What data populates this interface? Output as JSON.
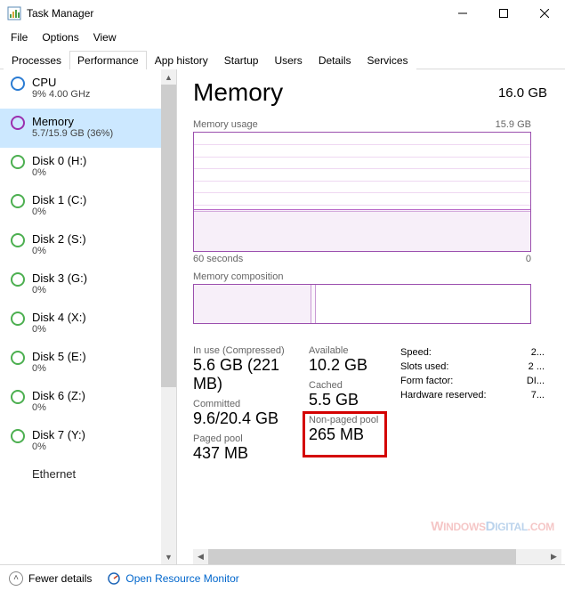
{
  "window": {
    "title": "Task Manager"
  },
  "menu": {
    "file": "File",
    "options": "Options",
    "view": "View"
  },
  "tabs": {
    "processes": "Processes",
    "performance": "Performance",
    "apphistory": "App history",
    "startup": "Startup",
    "users": "Users",
    "details": "Details",
    "services": "Services"
  },
  "sidebar": {
    "items": [
      {
        "label": "CPU",
        "sub": "9% 4.00 GHz",
        "ring": "blue"
      },
      {
        "label": "Memory",
        "sub": "5.7/15.9 GB (36%)",
        "ring": "purple"
      },
      {
        "label": "Disk 0 (H:)",
        "sub": "0%",
        "ring": "green"
      },
      {
        "label": "Disk 1 (C:)",
        "sub": "0%",
        "ring": "green"
      },
      {
        "label": "Disk 2 (S:)",
        "sub": "0%",
        "ring": "green"
      },
      {
        "label": "Disk 3 (G:)",
        "sub": "0%",
        "ring": "green"
      },
      {
        "label": "Disk 4 (X:)",
        "sub": "0%",
        "ring": "green"
      },
      {
        "label": "Disk 5 (E:)",
        "sub": "0%",
        "ring": "green"
      },
      {
        "label": "Disk 6 (Z:)",
        "sub": "0%",
        "ring": "green"
      },
      {
        "label": "Disk 7 (Y:)",
        "sub": "0%",
        "ring": "green"
      },
      {
        "label": "Ethernet",
        "sub": "",
        "ring": "green"
      }
    ],
    "selected": 1
  },
  "memory": {
    "title": "Memory",
    "total": "16.0 GB",
    "usage_label": "Memory usage",
    "usage_max": "15.9 GB",
    "timeaxis_left": "60 seconds",
    "timeaxis_right": "0",
    "composition_label": "Memory composition",
    "stats": {
      "inuse_label": "In use (Compressed)",
      "inuse_val": "5.6 GB (221 MB)",
      "available_label": "Available",
      "available_val": "10.2 GB",
      "committed_label": "Committed",
      "committed_val": "9.6/20.4 GB",
      "cached_label": "Cached",
      "cached_val": "5.5 GB",
      "pagedpool_label": "Paged pool",
      "pagedpool_val": "437 MB",
      "nonpaged_label": "Non-paged pool",
      "nonpaged_val": "265 MB"
    },
    "info": {
      "speed_k": "Speed:",
      "speed_v": "2...",
      "slots_k": "Slots used:",
      "slots_v": "2 ...",
      "form_k": "Form factor:",
      "form_v": "DI...",
      "hw_k": "Hardware reserved:",
      "hw_v": "7..."
    }
  },
  "footer": {
    "fewer": "Fewer details",
    "resmon": "Open Resource Monitor"
  },
  "watermark": {
    "part1": "W",
    "part2": "INDOWS",
    "part3": "D",
    "part4": "IGITAL",
    "part5": ".COM"
  }
}
